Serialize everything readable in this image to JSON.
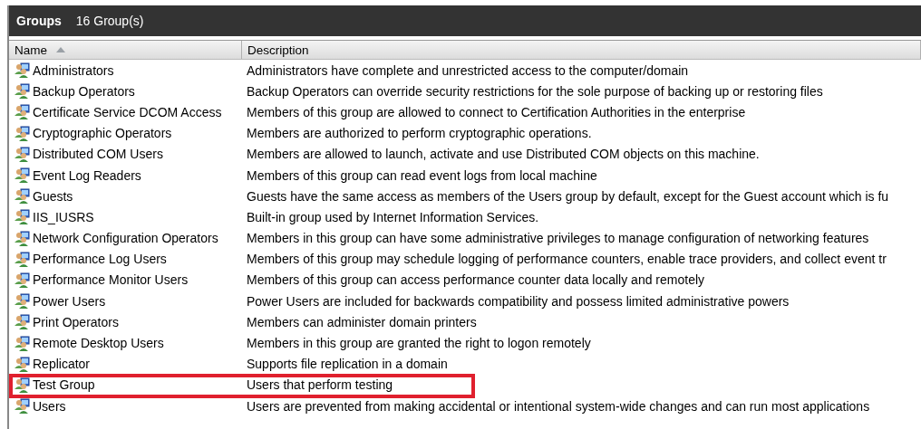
{
  "panel": {
    "title": "Groups",
    "count": "16 Group(s)"
  },
  "table": {
    "columns": [
      {
        "label": "Name",
        "sorted": true
      },
      {
        "label": "Description",
        "sorted": false
      }
    ],
    "rows": [
      {
        "name": "Administrators",
        "description": "Administrators have complete and unrestricted access to the computer/domain",
        "highlighted": false
      },
      {
        "name": "Backup Operators",
        "description": "Backup Operators can override security restrictions for the sole purpose of backing up or restoring files",
        "highlighted": false
      },
      {
        "name": "Certificate Service DCOM Access",
        "description": "Members of this group are allowed to connect to Certification Authorities in the enterprise",
        "highlighted": false
      },
      {
        "name": "Cryptographic Operators",
        "description": "Members are authorized to perform cryptographic operations.",
        "highlighted": false
      },
      {
        "name": "Distributed COM Users",
        "description": "Members are allowed to launch, activate and use Distributed COM objects on this machine.",
        "highlighted": false
      },
      {
        "name": "Event Log Readers",
        "description": "Members of this group can read event logs from local machine",
        "highlighted": false
      },
      {
        "name": "Guests",
        "description": "Guests have the same access as members of the Users group by default, except for the Guest account which is fu",
        "highlighted": false
      },
      {
        "name": "IIS_IUSRS",
        "description": "Built-in group used by Internet Information Services.",
        "highlighted": false
      },
      {
        "name": "Network Configuration Operators",
        "description": "Members in this group can have some administrative privileges to manage configuration of networking features",
        "highlighted": false
      },
      {
        "name": "Performance Log Users",
        "description": "Members of this group may schedule logging of performance counters, enable trace providers, and collect event tr",
        "highlighted": false
      },
      {
        "name": "Performance Monitor Users",
        "description": "Members of this group can access performance counter data locally and remotely",
        "highlighted": false
      },
      {
        "name": "Power Users",
        "description": "Power Users are included for backwards compatibility and possess limited administrative powers",
        "highlighted": false
      },
      {
        "name": "Print Operators",
        "description": "Members can administer domain printers",
        "highlighted": false
      },
      {
        "name": "Remote Desktop Users",
        "description": "Members in this group are granted the right to logon remotely",
        "highlighted": false
      },
      {
        "name": "Replicator",
        "description": "Supports file replication in a domain",
        "highlighted": false
      },
      {
        "name": "Test Group",
        "description": "Users that perform testing",
        "highlighted": true
      },
      {
        "name": "Users",
        "description": "Users are prevented from making accidental or intentional system-wide changes and can run most applications",
        "highlighted": false
      }
    ]
  }
}
